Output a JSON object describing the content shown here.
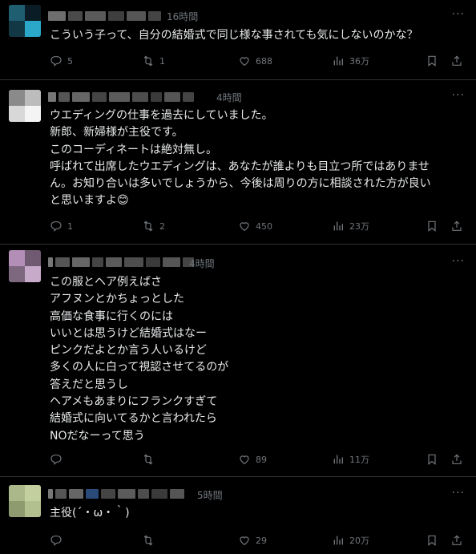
{
  "posts": [
    {
      "time": "16時間",
      "text": "こういう子って、自分の結婚式で同じ様な事されても気にしないのかな？",
      "reply_count": "5",
      "retweet_count": "1",
      "like_count": "688",
      "view_count": "36万",
      "more_label": "···"
    },
    {
      "time": "4時間",
      "text": "ウエディングの仕事を過去にしていました。\n新郎、新婦様が主役です。\nこのコーディネートは絶対無し。\n呼ばれて出席したウエディングは、あなたが誰よりも目立つ所ではありませ\nん。お知り合いは多いでしょうから、今後は周りの方に相談された方が良い\nと思いますよ😊",
      "reply_count": "1",
      "retweet_count": "2",
      "like_count": "450",
      "view_count": "23万",
      "more_label": "···"
    },
    {
      "time": "4時間",
      "text": "この服とヘア例えばさ\nアフヌンとかちょっとした\n高価な食事に行くのには\nいいとは思うけど結婚式はなー\nピンクだよとか言う人いるけど\n多くの人に白って視認させてるのが\n答えだと思うし\nヘアメもあまりにフランクすぎて\n結婚式に向いてるかと言われたら\nNOだなーって思う",
      "reply_count": "",
      "retweet_count": "",
      "like_count": "89",
      "view_count": "11万",
      "more_label": "···"
    },
    {
      "time": "5時間",
      "text": "主役(´・ω・｀)",
      "reply_count": "",
      "retweet_count": "",
      "like_count": "29",
      "view_count": "20万",
      "more_label": "···"
    }
  ],
  "colors": {
    "background": "#000000",
    "text": "#e7e9ea",
    "muted": "#71767b",
    "divider": "#2f3336"
  },
  "icons": [
    "reply-icon",
    "retweet-icon",
    "like-icon",
    "views-icon",
    "bookmark-icon",
    "share-icon",
    "more-icon"
  ]
}
